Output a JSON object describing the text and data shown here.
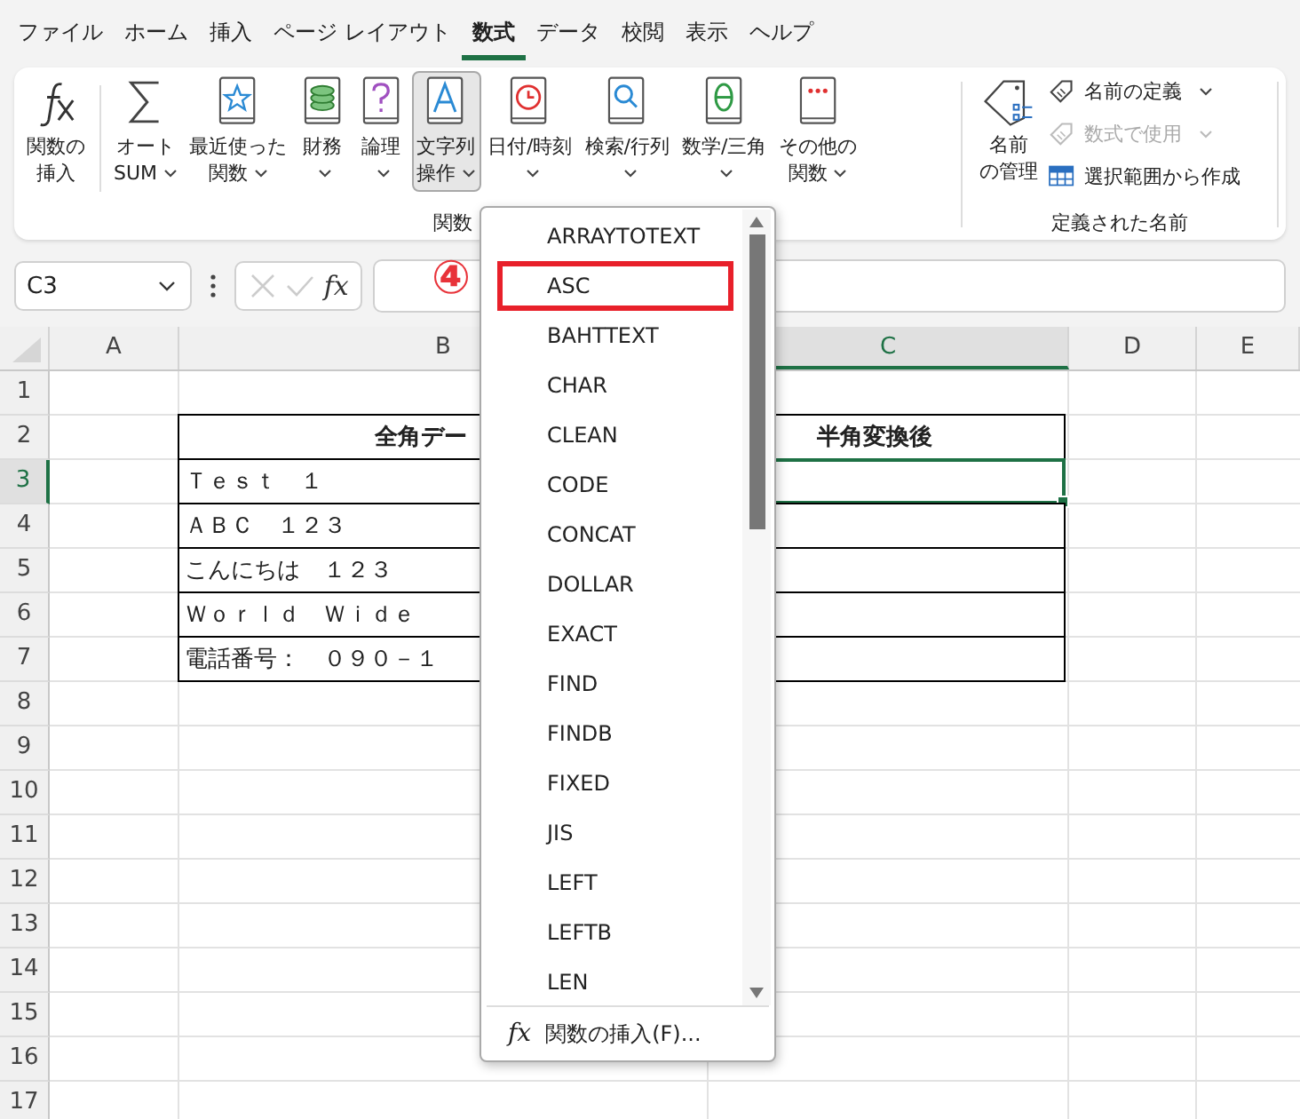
{
  "tabs": [
    {
      "label": "ファイル",
      "selected": false
    },
    {
      "label": "ホーム",
      "selected": false
    },
    {
      "label": "挿入",
      "selected": false
    },
    {
      "label": "ページ レイアウト",
      "selected": false
    },
    {
      "label": "数式",
      "selected": true
    },
    {
      "label": "データ",
      "selected": false
    },
    {
      "label": "校閲",
      "selected": false
    },
    {
      "label": "表示",
      "selected": false
    },
    {
      "label": "ヘルプ",
      "selected": false
    }
  ],
  "ribbon": {
    "library_buttons": [
      {
        "kind": "fx",
        "lines": [
          "関数の",
          "挿入"
        ],
        "dropdown": false,
        "selected": false
      },
      {
        "kind": "sum",
        "lines": [
          "オート",
          "SUM"
        ],
        "dropdown": true,
        "selected": false
      },
      {
        "kind": "star",
        "lines": [
          "最近使った",
          "関数"
        ],
        "dropdown": true,
        "selected": false
      },
      {
        "kind": "coins",
        "lines": [
          "財務"
        ],
        "dropdown": true,
        "selected": false
      },
      {
        "kind": "question",
        "lines": [
          "論理"
        ],
        "dropdown": true,
        "selected": false
      },
      {
        "kind": "letter",
        "lines": [
          "文字列",
          "操作"
        ],
        "dropdown": true,
        "selected": true
      },
      {
        "kind": "clock",
        "lines": [
          "日付/時刻"
        ],
        "dropdown": true,
        "selected": false
      },
      {
        "kind": "search",
        "lines": [
          "検索/行列"
        ],
        "dropdown": true,
        "selected": false
      },
      {
        "kind": "theta",
        "lines": [
          "数学/三角"
        ],
        "dropdown": true,
        "selected": false
      },
      {
        "kind": "dots",
        "lines": [
          "その他の",
          "関数"
        ],
        "dropdown": true,
        "selected": false
      }
    ],
    "library_label": "関数",
    "name_manager": [
      "名前",
      "の管理"
    ],
    "name_items": [
      {
        "kind": "tag",
        "label": "名前の定義",
        "dropdown": true,
        "disabled": false
      },
      {
        "kind": "tag-fx",
        "label": "数式で使用",
        "dropdown": true,
        "disabled": true
      },
      {
        "kind": "grid",
        "label": "選択範囲から作成",
        "dropdown": false,
        "disabled": false
      }
    ],
    "names_label": "定義された名前"
  },
  "formula_bar": {
    "name_box": "C3",
    "fx": "fx"
  },
  "sheet": {
    "columns": [
      {
        "label": "A",
        "selected": false
      },
      {
        "label": "B",
        "selected": false
      },
      {
        "label": "C",
        "selected": true
      },
      {
        "label": "D",
        "selected": false
      },
      {
        "label": "E",
        "selected": false
      }
    ],
    "rows": [
      {
        "number": "1",
        "selected": false,
        "bordered": false,
        "header": false,
        "cells": []
      },
      {
        "number": "2",
        "selected": false,
        "bordered": true,
        "header": true,
        "cells": [
          "",
          "全角デー",
          "半角変換後"
        ]
      },
      {
        "number": "3",
        "selected": true,
        "bordered": true,
        "header": false,
        "cells": [
          "",
          "Ｔｅｓｔ　１"
        ]
      },
      {
        "number": "4",
        "selected": false,
        "bordered": true,
        "header": false,
        "cells": [
          "",
          "ＡＢＣ　１２３"
        ]
      },
      {
        "number": "5",
        "selected": false,
        "bordered": true,
        "header": false,
        "cells": [
          "",
          "こんにちは　１２３"
        ]
      },
      {
        "number": "6",
        "selected": false,
        "bordered": true,
        "header": false,
        "cells": [
          "",
          "Ｗｏｒｌｄ　Ｗｉｄｅ"
        ]
      },
      {
        "number": "7",
        "selected": false,
        "bordered": true,
        "header": false,
        "cells": [
          "",
          "電話番号：　０９０－１"
        ]
      },
      {
        "number": "8",
        "selected": false,
        "bordered": false,
        "header": false,
        "cells": []
      },
      {
        "number": "9",
        "selected": false,
        "bordered": false,
        "header": false,
        "cells": []
      },
      {
        "number": "10",
        "selected": false,
        "bordered": false,
        "header": false,
        "cells": []
      },
      {
        "number": "11",
        "selected": false,
        "bordered": false,
        "header": false,
        "cells": []
      },
      {
        "number": "12",
        "selected": false,
        "bordered": false,
        "header": false,
        "cells": []
      },
      {
        "number": "13",
        "selected": false,
        "bordered": false,
        "header": false,
        "cells": []
      },
      {
        "number": "14",
        "selected": false,
        "bordered": false,
        "header": false,
        "cells": []
      },
      {
        "number": "15",
        "selected": false,
        "bordered": false,
        "header": false,
        "cells": []
      },
      {
        "number": "16",
        "selected": false,
        "bordered": false,
        "header": false,
        "cells": []
      },
      {
        "number": "17",
        "selected": false,
        "bordered": false,
        "header": false,
        "cells": []
      }
    ]
  },
  "menu": {
    "items": [
      {
        "label": "ARRAYTOTEXT",
        "outlined": false
      },
      {
        "label": "ASC",
        "outlined": true
      },
      {
        "label": "BAHTTEXT",
        "outlined": false
      },
      {
        "label": "CHAR",
        "outlined": false
      },
      {
        "label": "CLEAN",
        "outlined": false
      },
      {
        "label": "CODE",
        "outlined": false
      },
      {
        "label": "CONCAT",
        "outlined": false
      },
      {
        "label": "DOLLAR",
        "outlined": false
      },
      {
        "label": "EXACT",
        "outlined": false
      },
      {
        "label": "FIND",
        "outlined": false
      },
      {
        "label": "FINDB",
        "outlined": false
      },
      {
        "label": "FIXED",
        "outlined": false
      },
      {
        "label": "JIS",
        "outlined": false
      },
      {
        "label": "LEFT",
        "outlined": false
      },
      {
        "label": "LEFTB",
        "outlined": false
      },
      {
        "label": "LEN",
        "outlined": false
      }
    ],
    "footer_icon": "fx",
    "footer": "関数の挿入(F)..."
  },
  "step_marker": "④"
}
